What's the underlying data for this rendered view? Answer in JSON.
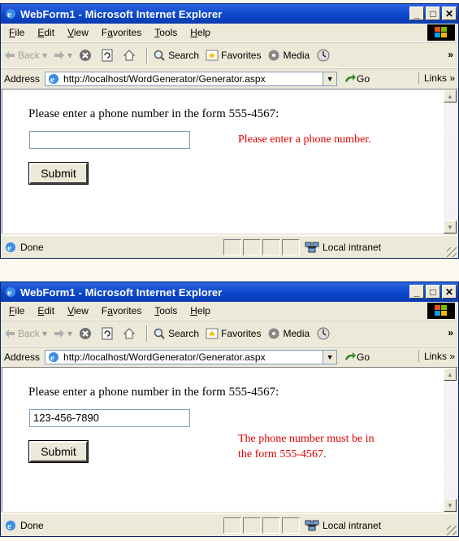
{
  "windows": [
    {
      "title": "WebForm1 - Microsoft Internet Explorer",
      "menu": [
        "File",
        "Edit",
        "View",
        "Favorites",
        "Tools",
        "Help"
      ],
      "menu_underline": [
        "F",
        "E",
        "V",
        "a",
        "T",
        "H"
      ],
      "toolbar": {
        "back": "Back",
        "search": "Search",
        "favorites": "Favorites",
        "media": "Media"
      },
      "address": {
        "label": "Address",
        "url": "http://localhost/WordGenerator/Generator.aspx",
        "go": "Go",
        "links": "Links"
      },
      "page": {
        "prompt": "Please enter a phone number in the form 555-4567:",
        "phone_value": "",
        "submit_label": "Submit",
        "error_lines": [
          "Please enter a phone number."
        ]
      },
      "status": {
        "text": "Done",
        "zone": "Local intranet"
      }
    },
    {
      "title": "WebForm1 - Microsoft Internet Explorer",
      "menu": [
        "File",
        "Edit",
        "View",
        "Favorites",
        "Tools",
        "Help"
      ],
      "menu_underline": [
        "F",
        "E",
        "V",
        "a",
        "T",
        "H"
      ],
      "toolbar": {
        "back": "Back",
        "search": "Search",
        "favorites": "Favorites",
        "media": "Media"
      },
      "address": {
        "label": "Address",
        "url": "http://localhost/WordGenerator/Generator.aspx",
        "go": "Go",
        "links": "Links"
      },
      "page": {
        "prompt": "Please enter a phone number in the form 555-4567:",
        "phone_value": "123-456-7890",
        "submit_label": "Submit",
        "error_lines": [
          "The phone number must be in",
          "the form 555-4567."
        ]
      },
      "status": {
        "text": "Done",
        "zone": "Local intranet"
      }
    }
  ],
  "colors": {
    "titlebar": "#0a45c9",
    "error_text": "#e00000",
    "chrome": "#ece9d8"
  },
  "icons": [
    "ie-icon",
    "minimize-icon",
    "maximize-icon",
    "close-icon",
    "windows-logo-icon",
    "back-arrow-icon",
    "forward-arrow-icon",
    "stop-icon",
    "refresh-icon",
    "home-icon",
    "search-icon",
    "favorites-icon",
    "media-icon",
    "history-icon",
    "page-icon",
    "go-arrow-icon",
    "intranet-icon"
  ]
}
